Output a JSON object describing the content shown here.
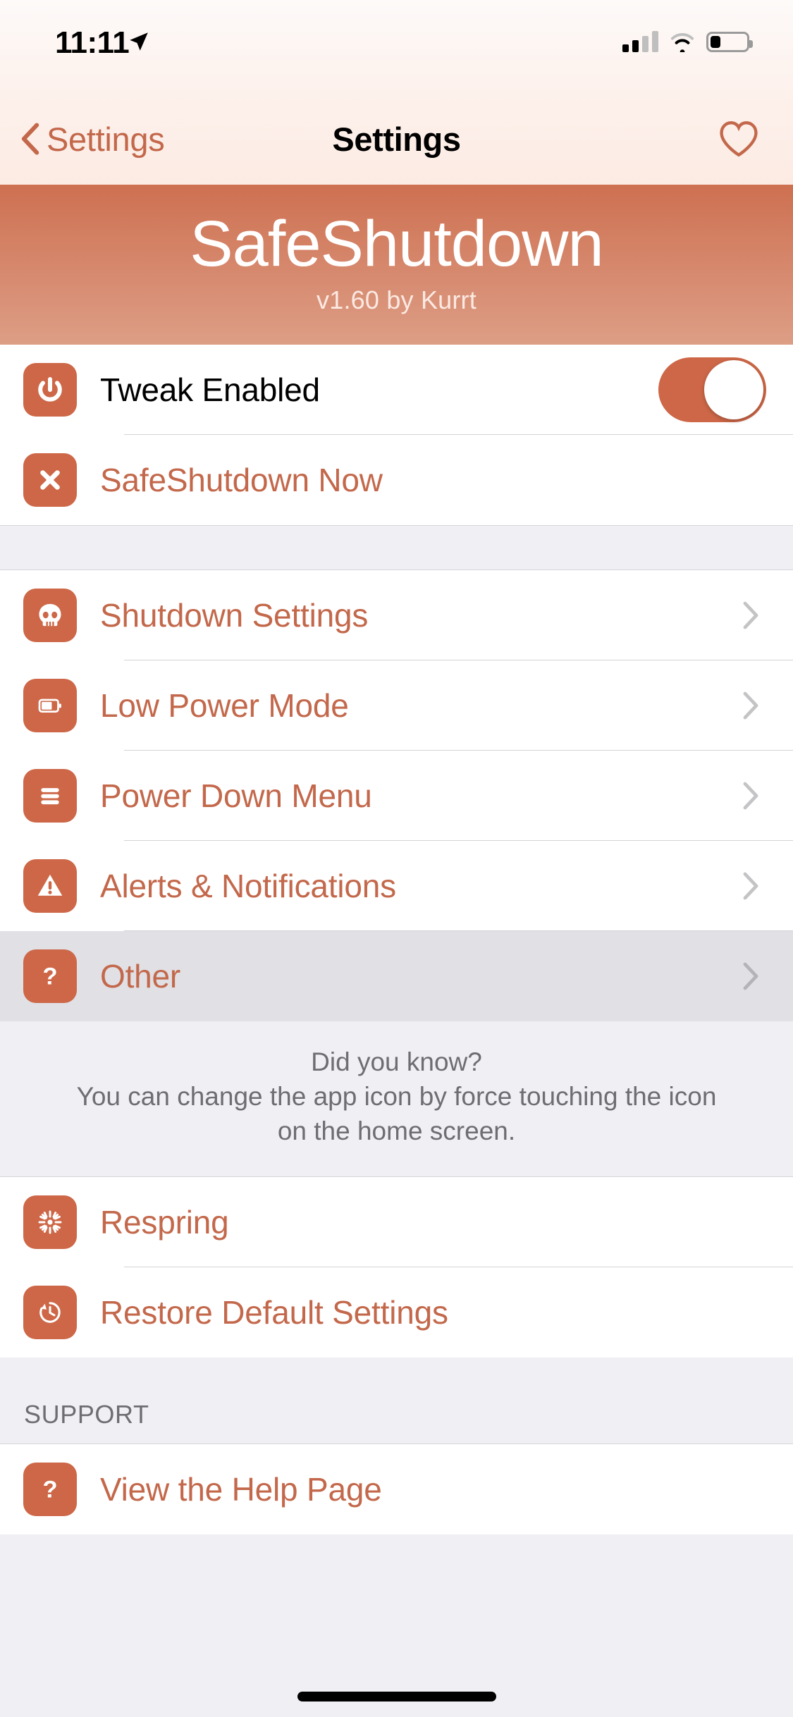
{
  "status_bar": {
    "time": "11:11",
    "location_icon": "location-arrow-icon",
    "signal_icon": "cellular-signal-icon",
    "signal_bars_filled": 2,
    "signal_bars_total": 4,
    "wifi_icon": "wifi-icon",
    "battery_icon": "battery-icon",
    "battery_level_percent": 28
  },
  "nav_bar": {
    "back_label": "Settings",
    "back_icon": "chevron-left-icon",
    "title": "Settings",
    "favorite_icon": "heart-outline-icon"
  },
  "banner": {
    "title": "SafeShutdown",
    "subtitle": "v1.60 by Kurrt"
  },
  "theme": {
    "accent": "#C3684B",
    "icon_background": "#CD6747",
    "banner_top": "#CE7051",
    "banner_bottom": "#DD9E86",
    "group_background": "#EFEFF4",
    "row_background": "#FFFFFF",
    "row_highlight": "#E0E0E5",
    "footer_text": "#6D6D72"
  },
  "groups": [
    {
      "name": "main-actions",
      "rows": [
        {
          "label": "Tweak Enabled",
          "icon": "power-icon",
          "label_color": "dark",
          "control": "toggle",
          "toggle_on": true
        },
        {
          "label": "SafeShutdown Now",
          "icon": "close-x-icon",
          "label_color": "accent",
          "control": "none"
        }
      ]
    },
    {
      "name": "settings-pages",
      "rows": [
        {
          "label": "Shutdown Settings",
          "icon": "skull-icon",
          "label_color": "accent",
          "control": "chevron"
        },
        {
          "label": "Low Power Mode",
          "icon": "battery-icon",
          "label_color": "accent",
          "control": "chevron"
        },
        {
          "label": "Power Down Menu",
          "icon": "list-menu-icon",
          "label_color": "accent",
          "control": "chevron"
        },
        {
          "label": "Alerts & Notifications",
          "icon": "warning-triangle-icon",
          "label_color": "accent",
          "control": "chevron"
        },
        {
          "label": "Other",
          "icon": "question-mark-icon",
          "label_color": "accent",
          "control": "chevron",
          "highlighted": true
        }
      ]
    },
    {
      "name": "maintenance",
      "rows": [
        {
          "label": "Respring",
          "icon": "spinner-burst-icon",
          "label_color": "accent",
          "control": "none"
        },
        {
          "label": "Restore Default Settings",
          "icon": "history-clock-icon",
          "label_color": "accent",
          "control": "none"
        }
      ]
    },
    {
      "name": "support",
      "header": "SUPPORT",
      "rows": [
        {
          "label": "View the Help Page",
          "icon": "question-mark-icon",
          "label_color": "accent",
          "control": "none"
        }
      ]
    }
  ],
  "footer_note": {
    "line1": "Did you know?",
    "line2": "You can change the app icon by force touching the icon",
    "line3": "on the home screen."
  }
}
